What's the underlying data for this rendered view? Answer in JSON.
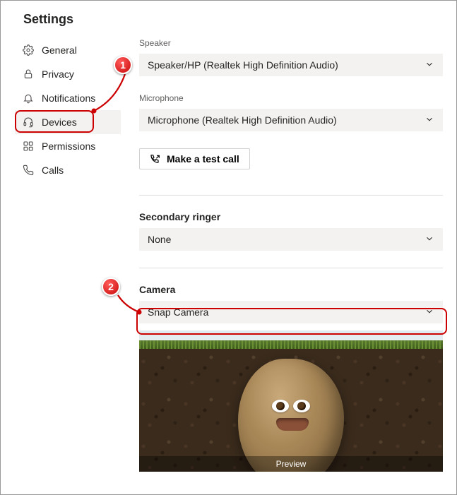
{
  "page_title": "Settings",
  "sidebar": {
    "items": [
      {
        "label": "General"
      },
      {
        "label": "Privacy"
      },
      {
        "label": "Notifications"
      },
      {
        "label": "Devices"
      },
      {
        "label": "Permissions"
      },
      {
        "label": "Calls"
      }
    ]
  },
  "devices": {
    "speaker_label": "Speaker",
    "speaker_value": "Speaker/HP (Realtek High Definition Audio)",
    "microphone_label": "Microphone",
    "microphone_value": "Microphone (Realtek High Definition Audio)",
    "test_call_label": "Make a test call",
    "secondary_ringer_label": "Secondary ringer",
    "secondary_ringer_value": "None",
    "camera_label": "Camera",
    "camera_value": "Snap Camera",
    "preview_label": "Preview"
  },
  "annotations": {
    "callout1": "1",
    "callout2": "2"
  }
}
